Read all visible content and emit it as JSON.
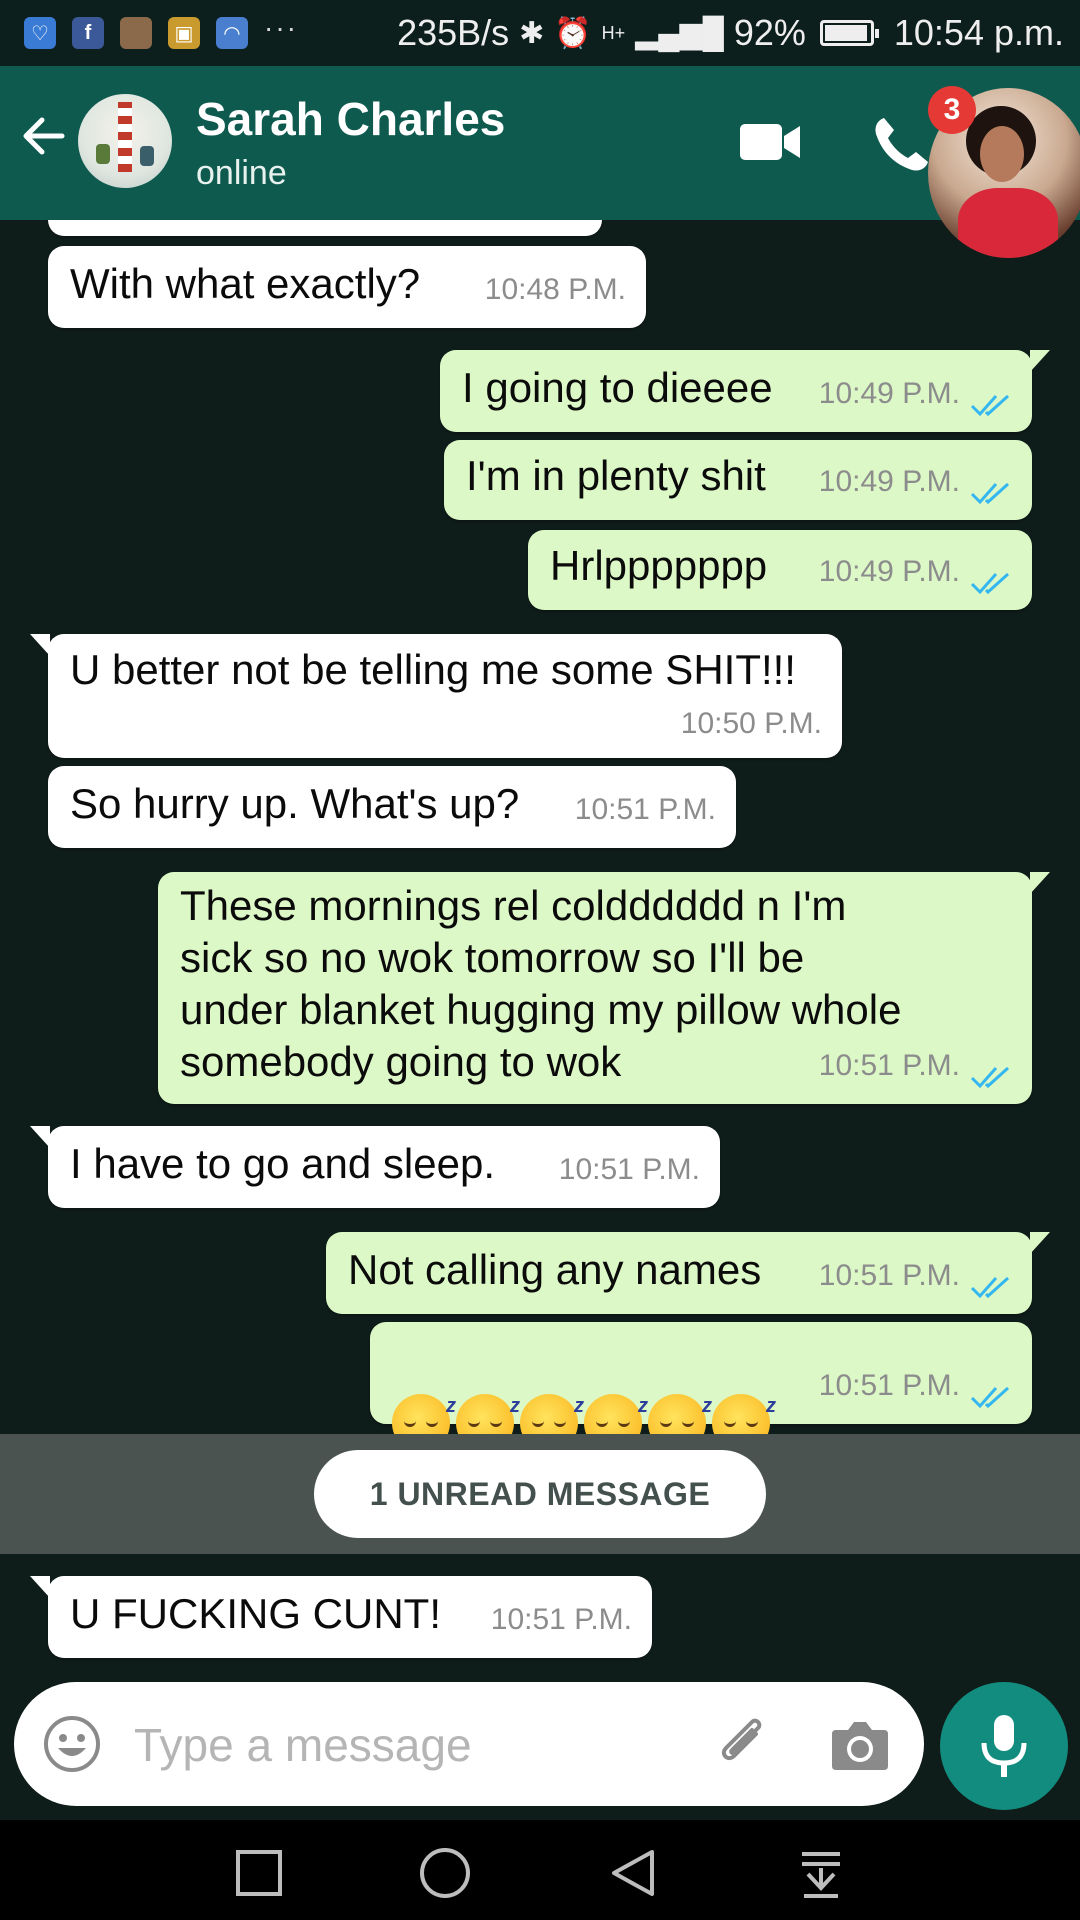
{
  "status_bar": {
    "net_speed": "235B/s",
    "battery_pct": "92%",
    "time": "10:54 p.m.",
    "overflow": "···",
    "network": "H+",
    "notification_icons": [
      "health-app-icon",
      "facebook-icon",
      "photo-icon",
      "app-icon",
      "wifi-icon"
    ]
  },
  "header": {
    "contact_name": "Sarah Charles",
    "contact_status": "online",
    "chathead_badge": "3"
  },
  "colors": {
    "header_bg": "#0e5a4f",
    "chat_bg": "#0f1d1a",
    "incoming_bubble": "#ffffff",
    "outgoing_bubble": "#dcf8c6",
    "read_ticks": "#34b7f1",
    "accent": "#128c7e",
    "badge": "#e53935"
  },
  "messages": [
    {
      "direction": "in",
      "text": "With what exactly?",
      "time": "10:48 P.M."
    },
    {
      "direction": "out",
      "text": "I going to dieeee",
      "time": "10:49 P.M.",
      "status": "read"
    },
    {
      "direction": "out",
      "text": "I'm in plenty shit",
      "time": "10:49 P.M.",
      "status": "read"
    },
    {
      "direction": "out",
      "text": "Hrlppppppp",
      "time": "10:49 P.M.",
      "status": "read"
    },
    {
      "direction": "in",
      "text": "U better not be telling me some SHIT!!!",
      "time": "10:50 P.M."
    },
    {
      "direction": "in",
      "text": "So hurry up. What's up?",
      "time": "10:51 P.M."
    },
    {
      "direction": "out",
      "text": "These mornings rel coldddddd n I'm\nsick so no wok tomorrow so I'll be\nunder blanket hugging my pillow whole\nsomebody going to wok",
      "time": "10:51 P.M.",
      "status": "read"
    },
    {
      "direction": "in",
      "text": "I have to go and sleep.",
      "time": "10:51 P.M."
    },
    {
      "direction": "out",
      "text": "Not calling any names",
      "time": "10:51 P.M.",
      "status": "read"
    },
    {
      "direction": "out",
      "emoji": "sleeping-face",
      "emoji_count": 6,
      "time": "10:51 P.M.",
      "status": "read"
    },
    {
      "direction": "in",
      "text": "U FUCKING  CUNT!",
      "time": "10:51 P.M."
    }
  ],
  "unread_divider": "1 UNREAD MESSAGE",
  "composer": {
    "placeholder": "Type a message",
    "value": ""
  },
  "icons": {
    "back": "back-arrow-icon",
    "video": "video-call-icon",
    "call": "voice-call-icon",
    "emoji": "emoji-icon",
    "attach": "paperclip-icon",
    "camera": "camera-icon",
    "mic": "mic-icon",
    "nav": [
      "recents-icon",
      "home-icon",
      "back-icon",
      "notification-drawer-icon"
    ]
  }
}
